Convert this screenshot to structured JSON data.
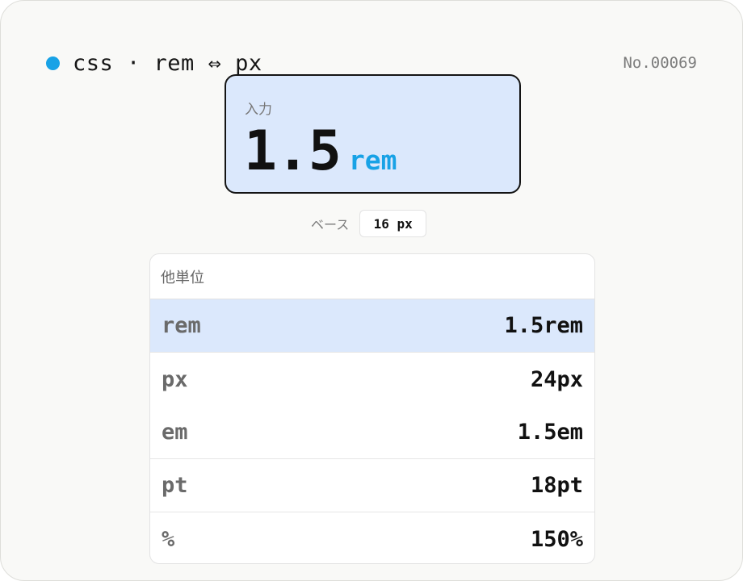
{
  "header": {
    "title": "css · rem ⇔ px",
    "serial": "No.00069"
  },
  "input": {
    "label": "入力",
    "value": "1.5",
    "unit": "rem"
  },
  "base": {
    "label": "ベース",
    "value": "16 px"
  },
  "units_table": {
    "heading": "他単位",
    "rows": [
      {
        "unit": "rem",
        "value": "1.5rem",
        "selected": true
      },
      {
        "unit": "px",
        "value": "24px",
        "selected": false
      },
      {
        "unit": "em",
        "value": "1.5em",
        "selected": false
      },
      {
        "unit": "pt",
        "value": "18pt",
        "selected": false
      },
      {
        "unit": "%",
        "value": "150%",
        "selected": false
      }
    ]
  },
  "colors": {
    "accent": "#18a2e6",
    "highlight": "#dbe8fc",
    "card_background": "#f9f9f7"
  }
}
